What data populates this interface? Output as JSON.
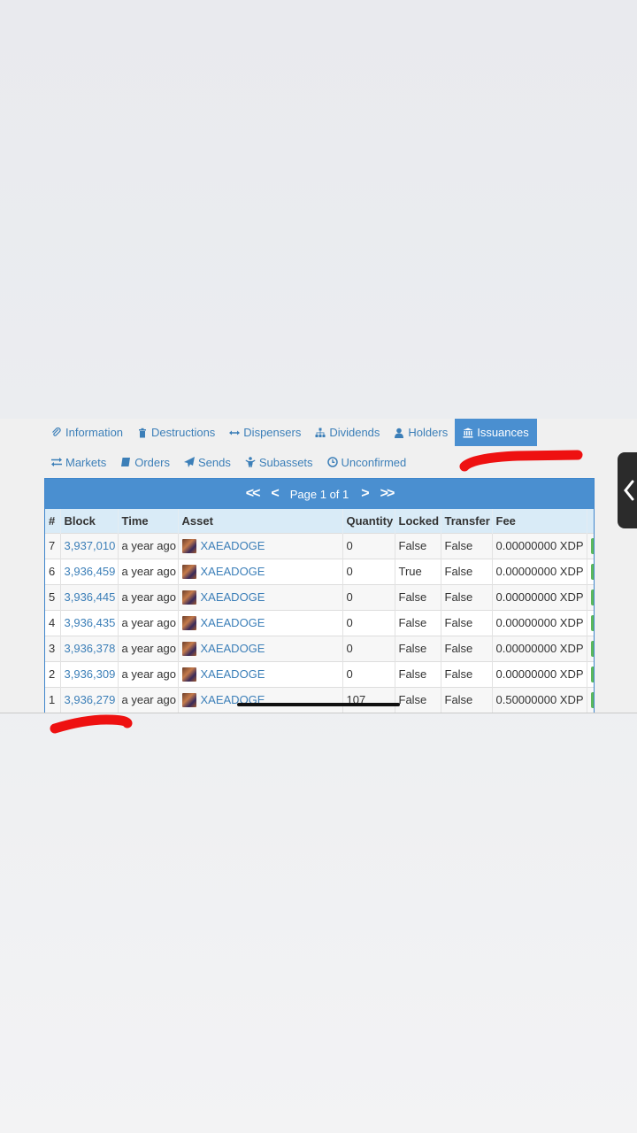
{
  "tabs_row1": [
    {
      "label": "Information",
      "icon": "paperclip-icon"
    },
    {
      "label": "Destructions",
      "icon": "trash-icon"
    },
    {
      "label": "Dispensers",
      "icon": "arrows-horizontal-icon"
    },
    {
      "label": "Dividends",
      "icon": "sitemap-icon"
    },
    {
      "label": "Holders",
      "icon": "user-icon"
    },
    {
      "label": "Issuances",
      "icon": "bank-icon",
      "active": true
    }
  ],
  "tabs_row2": [
    {
      "label": "Markets",
      "icon": "exchange-icon"
    },
    {
      "label": "Orders",
      "icon": "book-icon"
    },
    {
      "label": "Sends",
      "icon": "send-icon"
    },
    {
      "label": "Subassets",
      "icon": "child-icon"
    },
    {
      "label": "Unconfirmed",
      "icon": "clock-icon"
    }
  ],
  "pager": {
    "first": "<<",
    "prev": "<",
    "page_text": "Page 1 of 1",
    "next": ">",
    "last": ">>"
  },
  "table": {
    "headers": [
      "#",
      "Block",
      "Time",
      "Asset",
      "Quantity",
      "Locked",
      "Transfer",
      "Fee"
    ],
    "rows": [
      {
        "num": "7",
        "block": "3,937,010",
        "time": "a year ago",
        "asset": "XAEADOGE",
        "quantity": "0",
        "locked": "False",
        "transfer": "False",
        "fee": "0.00000000 XDP"
      },
      {
        "num": "6",
        "block": "3,936,459",
        "time": "a year ago",
        "asset": "XAEADOGE",
        "quantity": "0",
        "locked": "True",
        "transfer": "False",
        "fee": "0.00000000 XDP"
      },
      {
        "num": "5",
        "block": "3,936,445",
        "time": "a year ago",
        "asset": "XAEADOGE",
        "quantity": "0",
        "locked": "False",
        "transfer": "False",
        "fee": "0.00000000 XDP"
      },
      {
        "num": "4",
        "block": "3,936,435",
        "time": "a year ago",
        "asset": "XAEADOGE",
        "quantity": "0",
        "locked": "False",
        "transfer": "False",
        "fee": "0.00000000 XDP"
      },
      {
        "num": "3",
        "block": "3,936,378",
        "time": "a year ago",
        "asset": "XAEADOGE",
        "quantity": "0",
        "locked": "False",
        "transfer": "False",
        "fee": "0.00000000 XDP"
      },
      {
        "num": "2",
        "block": "3,936,309",
        "time": "a year ago",
        "asset": "XAEADOGE",
        "quantity": "0",
        "locked": "False",
        "transfer": "False",
        "fee": "0.00000000 XDP"
      },
      {
        "num": "1",
        "block": "3,936,279",
        "time": "a year ago",
        "asset": "XAEADOGE",
        "quantity": "107",
        "locked": "False",
        "transfer": "False",
        "fee": "0.50000000 XDP"
      }
    ]
  },
  "colors": {
    "accent": "#4a8fd0",
    "link": "#3c7fb8",
    "header_row": "#d9ebf7",
    "annotation": "#ee1111",
    "action_button": "#5cb85c"
  }
}
